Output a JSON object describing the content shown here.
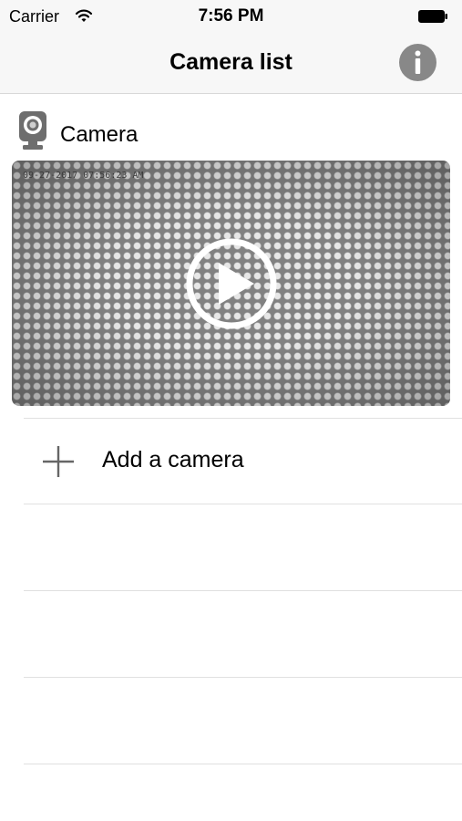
{
  "status_bar": {
    "carrier": "Carrier",
    "time": "7:56 PM",
    "wifi_icon": "wifi-icon",
    "battery_icon": "battery-icon"
  },
  "nav": {
    "title": "Camera list",
    "info_icon": "info-icon"
  },
  "cameras": [
    {
      "name": "Camera",
      "icon": "camera-icon",
      "timestamp": "09-27-2017 07:56:23 AM",
      "play_icon": "play-icon"
    }
  ],
  "add_camera": {
    "label": "Add a camera",
    "icon": "plus-icon"
  },
  "colors": {
    "bar_background": "#f7f7f7",
    "info_button": "#888888",
    "separator": "#e0e0e0"
  }
}
